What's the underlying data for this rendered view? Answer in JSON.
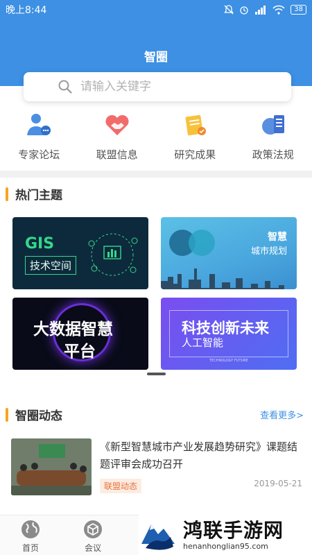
{
  "status_bar": {
    "time": "晚上8:44",
    "battery": "38"
  },
  "header": {
    "title": "智圈"
  },
  "search": {
    "placeholder": "请输入关键字"
  },
  "nav": [
    {
      "label": "专家论坛",
      "icon": "expert-icon"
    },
    {
      "label": "联盟信息",
      "icon": "handshake-heart-icon"
    },
    {
      "label": "研究成果",
      "icon": "research-icon"
    },
    {
      "label": "政策法规",
      "icon": "policy-icon"
    }
  ],
  "hot_topics": {
    "title": "热门主题",
    "cards": [
      {
        "line1": "GIS",
        "line2": "技术空间"
      },
      {
        "line1": "智慧",
        "line2": "城市规划"
      },
      {
        "line1": "大数据智慧",
        "line2": "平台"
      },
      {
        "line1": "科技创新未来",
        "line2": "人工智能",
        "tiny": "TECHNOLOGY FUTURE"
      }
    ]
  },
  "news": {
    "title": "智圈动态",
    "more": "查看更多>",
    "items": [
      {
        "title": "《新型智慧城市产业发展趋势研究》课题结题评审会成功召开",
        "tag": "联盟动态",
        "date": "2019-05-21"
      }
    ]
  },
  "tabbar": {
    "items": [
      {
        "label": "首页"
      },
      {
        "label": "会议"
      }
    ]
  },
  "watermark": {
    "main": "鸿联手游网",
    "sub": "henanhonglian95.com"
  },
  "colors": {
    "primary": "#3d90e3",
    "accent": "#f5a623",
    "tag": "#e8743b"
  }
}
